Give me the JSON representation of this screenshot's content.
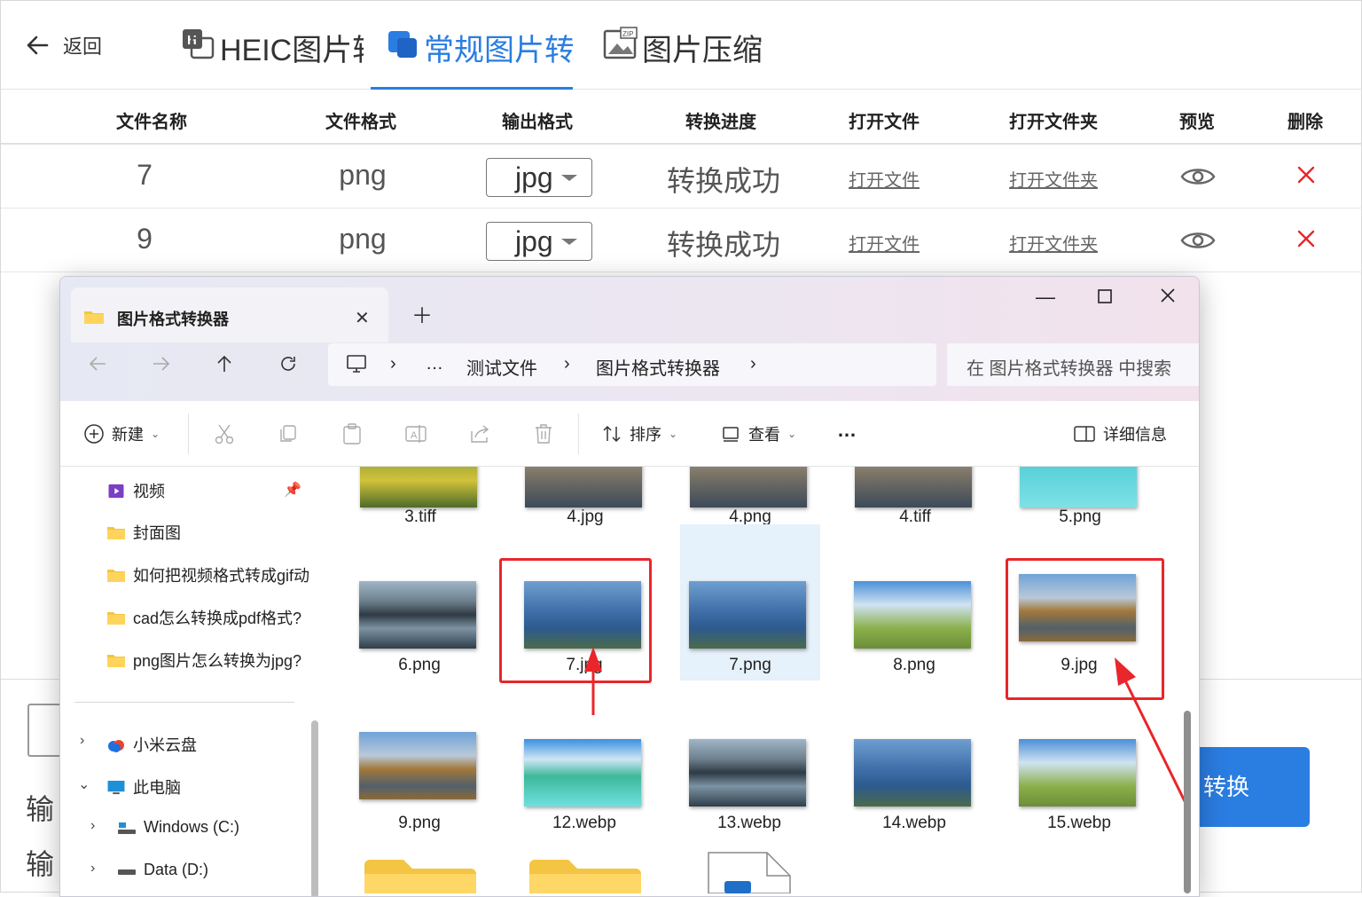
{
  "app": {
    "back_label": "返回",
    "tabs": [
      {
        "label": "HEIC图片转换",
        "active": false
      },
      {
        "label": "常规图片转换",
        "active": true
      },
      {
        "label": "图片压缩",
        "active": false
      }
    ],
    "accent_color": "#2a7de1"
  },
  "table": {
    "headers": [
      "文件名称",
      "文件格式",
      "输出格式",
      "转换进度",
      "打开文件",
      "打开文件夹",
      "预览",
      "删除"
    ],
    "rows": [
      {
        "name": "7",
        "format": "png",
        "output": "jpg",
        "status": "转换成功",
        "open_file": "打开文件",
        "open_folder": "打开文件夹"
      },
      {
        "name": "9",
        "format": "png",
        "output": "jpg",
        "status": "转换成功",
        "open_file": "打开文件",
        "open_folder": "打开文件夹"
      }
    ]
  },
  "background": {
    "output_label_1": "输",
    "output_label_2": "输",
    "convert_button": "转换"
  },
  "explorer": {
    "tab_title": "图片格式转换器",
    "breadcrumb": [
      "…",
      "测试文件",
      "图片格式转换器"
    ],
    "search_placeholder": "在 图片格式转换器 中搜索",
    "commands": {
      "new": "新建",
      "sort": "排序",
      "view": "查看",
      "more": "…",
      "details": "详细信息"
    },
    "nav_items": [
      {
        "label": "视频",
        "icon": "video-icon"
      },
      {
        "label": "封面图",
        "icon": "folder-icon"
      },
      {
        "label": "如何把视频格式转成gif动",
        "icon": "folder-icon"
      },
      {
        "label": "cad怎么转换成pdf格式?",
        "icon": "folder-icon"
      },
      {
        "label": "png图片怎么转换为jpg?",
        "icon": "folder-icon"
      },
      {
        "label": "小米云盘",
        "icon": "cloud-icon"
      },
      {
        "label": "此电脑",
        "icon": "computer-icon"
      },
      {
        "label": "Windows (C:)",
        "icon": "drive-icon"
      },
      {
        "label": "Data (D:)",
        "icon": "drive-icon"
      }
    ],
    "files_row1": [
      "3.tiff",
      "4.jpg",
      "4.png",
      "4.tiff",
      "5.png"
    ],
    "files_row2": [
      "6.png",
      "7.jpg",
      "7.png",
      "8.png",
      "9.jpg"
    ],
    "files_row3": [
      "9.png",
      "12.webp",
      "13.webp",
      "14.webp",
      "15.webp"
    ],
    "selected_file": "7.png",
    "highlighted_files": [
      "7.jpg",
      "9.jpg"
    ],
    "highlight_color": "#e8262b"
  }
}
